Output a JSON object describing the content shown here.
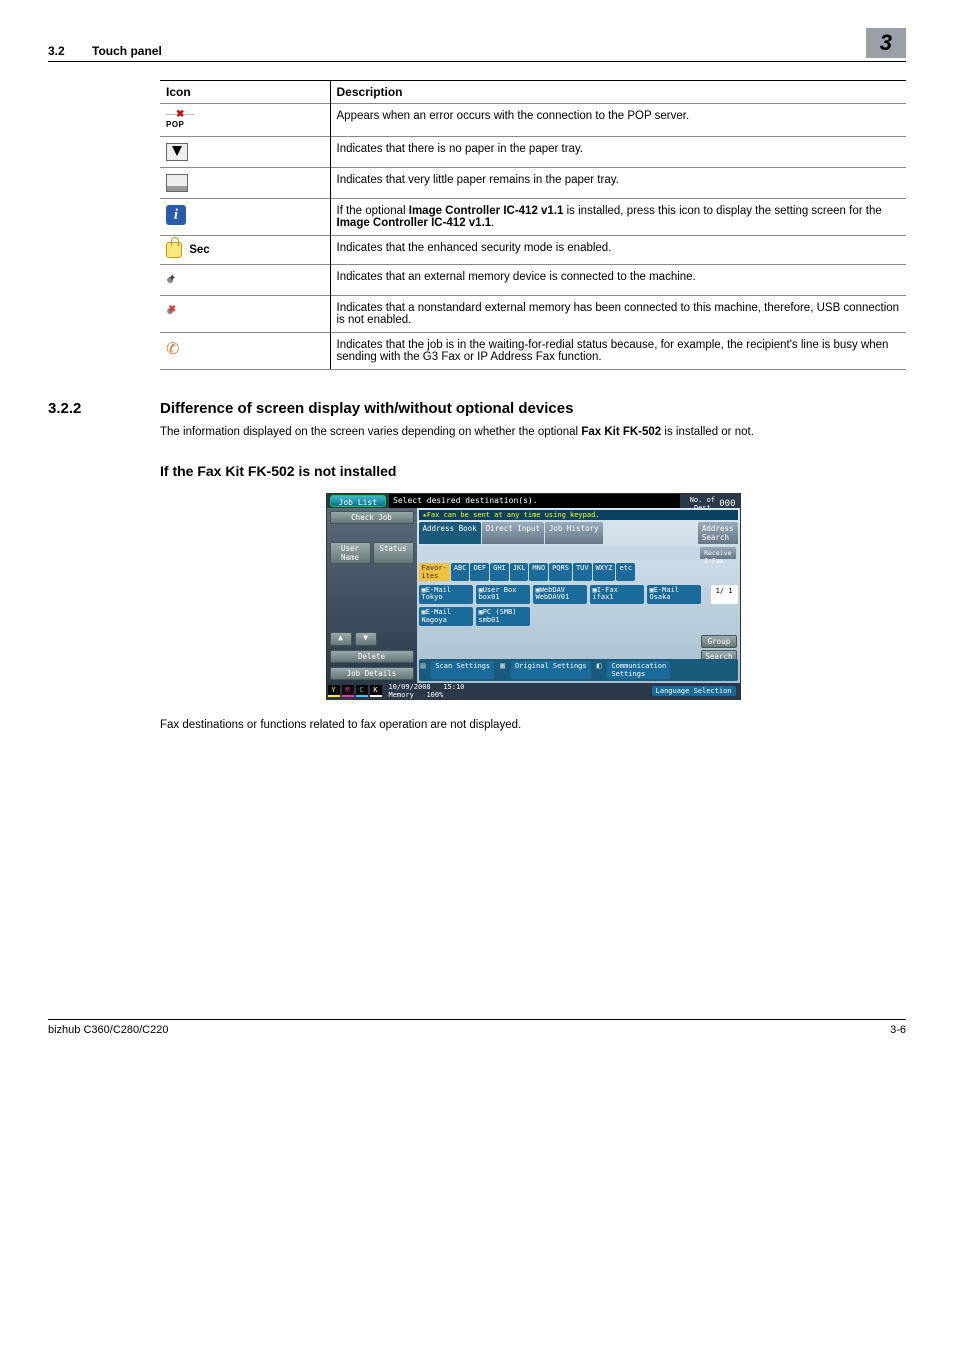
{
  "header": {
    "section_number": "3.2",
    "section_title": "Touch panel",
    "chapter_badge": "3"
  },
  "icon_table": {
    "col1": "Icon",
    "col2": "Description",
    "rows": [
      {
        "icon_name": "pop-error-icon",
        "desc": "Appears when an error occurs with the connection to the POP server."
      },
      {
        "icon_name": "no-paper-icon",
        "desc": "Indicates that there is no paper in the paper tray."
      },
      {
        "icon_name": "low-paper-icon",
        "desc": "Indicates that very little paper remains in the paper tray."
      },
      {
        "icon_name": "info-icon",
        "desc_pre": "If the optional ",
        "bold1": "Image Controller IC-412 v1.1",
        "desc_mid": " is installed, press this icon to display the setting screen for the ",
        "bold2": "Image Controller IC-412 v1.1",
        "desc_post": "."
      },
      {
        "icon_name": "security-icon",
        "icon_label": "Sec",
        "desc": "Indicates that the enhanced security mode is enabled."
      },
      {
        "icon_name": "ext-memory-icon",
        "desc": "Indicates that an external memory device is connected to the machine."
      },
      {
        "icon_name": "ext-memory-disabled-icon",
        "desc": "Indicates that a nonstandard external memory has been connected to this machine, therefore, USB connection is not enabled."
      },
      {
        "icon_name": "redial-wait-icon",
        "desc": "Indicates that the job is in the waiting-for-redial status because, for example, the recipient's line is busy when sending with the G3 Fax or IP Address Fax function."
      }
    ]
  },
  "section_322": {
    "number": "3.2.2",
    "title": "Difference of screen display with/without optional devices",
    "intro_pre": "The information displayed on the screen varies depending on whether the optional ",
    "intro_bold": "Fax Kit FK-502",
    "intro_post": " is installed or not.",
    "sub_heading": "If the Fax Kit FK-502 is not installed",
    "caption": "Fax destinations or functions related to fax operation are not displayed."
  },
  "mfd": {
    "job_list": "Job List",
    "instruction": "Select desired destination(s).",
    "dest_label": "No. of\nDest.",
    "dest_count": "000",
    "check_job": "Check Job",
    "hint": "Fax can be sent at any time using keypad.",
    "tabs": {
      "address_book": "Address Book",
      "direct_input": "Direct Input",
      "job_history": "Job History",
      "addr_search": "Address\nSearch"
    },
    "receive_ifax": "Receive\nI-Fax",
    "left_panel": {
      "name": "User\nName",
      "status": "Status",
      "delete": "Delete",
      "job_details": "Job Details"
    },
    "alpha": {
      "fav": "Favor-\nites",
      "keys": [
        "ABC",
        "DEF",
        "GHI",
        "JKL",
        "MNO",
        "PQRS",
        "TUV",
        "WXYZ",
        "etc"
      ]
    },
    "dests": [
      {
        "type": "E-Mail",
        "name": "Tokyo"
      },
      {
        "type": "User Box",
        "name": "box01"
      },
      {
        "type": "WebDAV",
        "name": "WebDAV01"
      },
      {
        "type": "I-Fax",
        "name": "ifax1"
      },
      {
        "type": "E-Mail",
        "name": "Osaka"
      },
      {
        "type": "E-Mail",
        "name": "Nagoya"
      },
      {
        "type": "PC (SMB)",
        "name": "smb01"
      }
    ],
    "page_ind": "1/  1",
    "group": "Group",
    "search": "Search",
    "bottom": {
      "scan": "Scan Settings",
      "orig": "Original Settings",
      "comm": "Communication\nSettings"
    },
    "status_bar": {
      "date": "10/09/2008",
      "time": "15:10",
      "mem_label": "Memory",
      "mem_val": "100%",
      "lang": "Language Selection"
    },
    "toner": [
      "Y",
      "M",
      "C",
      "K"
    ]
  },
  "footer": {
    "left": "bizhub C360/C280/C220",
    "right": "3-6"
  }
}
